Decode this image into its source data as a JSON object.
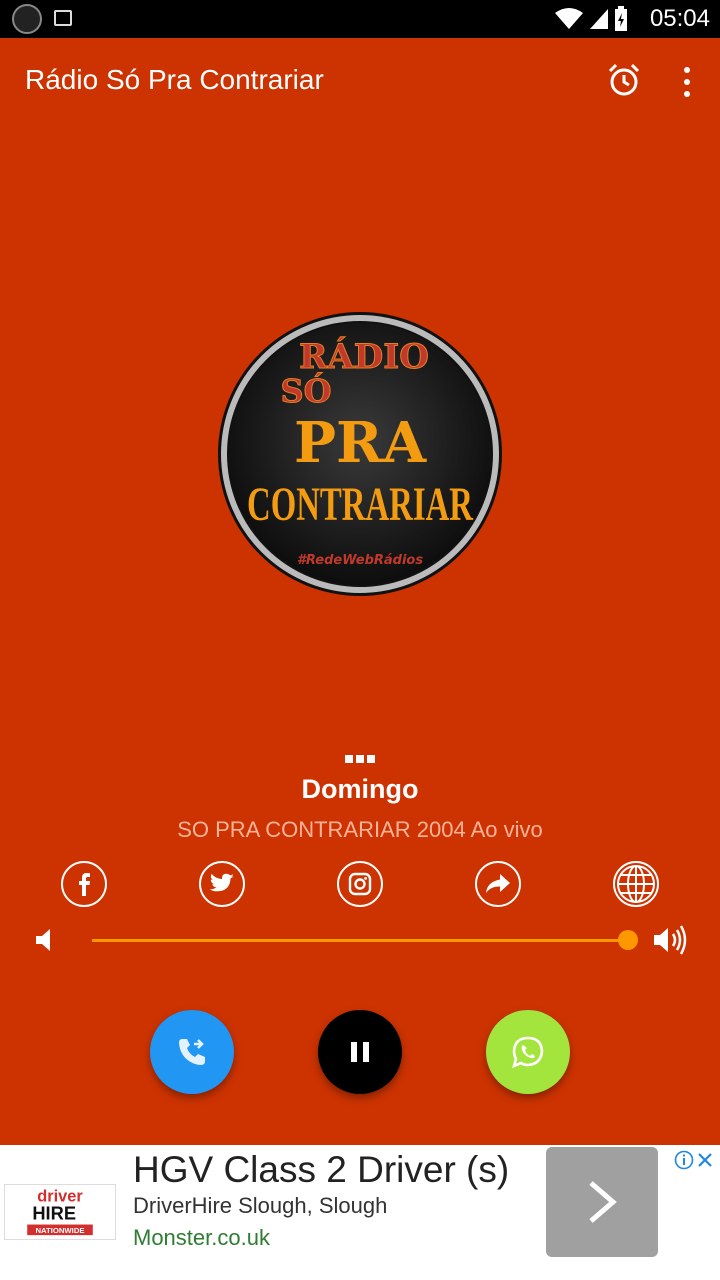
{
  "status_bar": {
    "time": "05:04"
  },
  "app_bar": {
    "title": "Rádio Só Pra Contrariar",
    "alarm_icon": "alarm-icon",
    "menu_icon": "more-vert-icon"
  },
  "logo": {
    "line1": "RÁDIO",
    "line2": "SÓ",
    "line3": "PRA",
    "line4": "CONTRARIAR",
    "tag": "#RedeWebRádios"
  },
  "now_playing": {
    "title": "Domingo",
    "artist": "SO PRA CONTRARIAR 2004 Ao vivo"
  },
  "social": [
    "facebook-icon",
    "twitter-icon",
    "instagram-icon",
    "share-icon",
    "globe-icon"
  ],
  "volume": {
    "level": 1.0,
    "accent": "#ff9800"
  },
  "controls": {
    "call_color": "#2196f3",
    "pause_color": "#000000",
    "whatsapp_color": "#a4e53d"
  },
  "ad": {
    "headline": "HGV Class 2 Driver (s)",
    "advertiser": "DriverHire Slough, Slough",
    "domain": "Monster.co.uk",
    "logo_top": "driver",
    "logo_mid": "HIRE",
    "logo_bottom": "NATIONWIDE"
  },
  "colors": {
    "background": "#cc3300",
    "artist_text": "#ffb39a"
  }
}
